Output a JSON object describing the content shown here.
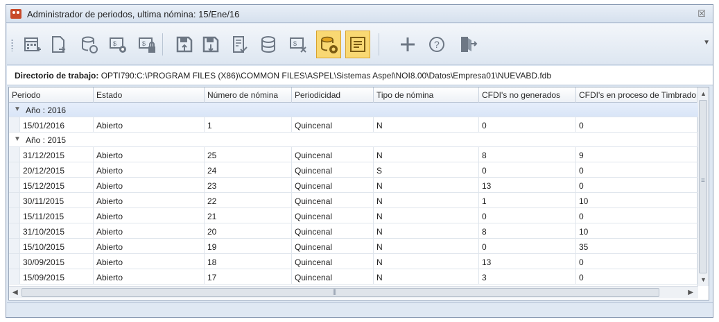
{
  "window": {
    "title": "Administrador de periodos, ultima nómina: 15/Ene/16",
    "close": "☒"
  },
  "toolbar": {
    "buttons": [
      {
        "name": "calendar-add-icon",
        "active": false
      },
      {
        "name": "document-arrow-icon",
        "active": false
      },
      {
        "name": "database-sync-icon",
        "active": false
      },
      {
        "name": "payroll-settings-icon",
        "active": false
      },
      {
        "name": "payroll-lock-icon",
        "active": false
      },
      {
        "name": "save-up-icon",
        "active": false
      },
      {
        "name": "save-down-icon",
        "active": false
      },
      {
        "name": "document-check-icon",
        "active": false
      },
      {
        "name": "database-list-icon",
        "active": false
      },
      {
        "name": "payroll-cancel-icon",
        "active": false
      },
      {
        "name": "database-gear-icon",
        "active": true
      },
      {
        "name": "notes-icon",
        "active": true
      },
      {
        "name": "add-icon",
        "active": false
      },
      {
        "name": "help-icon",
        "active": false
      },
      {
        "name": "exit-icon",
        "active": false
      }
    ]
  },
  "workdir": {
    "label": "Directorio de trabajo:",
    "path": " OPTI790:C:\\PROGRAM FILES (X86)\\COMMON FILES\\ASPEL\\Sistemas Aspel\\NOI8.00\\Datos\\Empresa01\\NUEVABD.fdb"
  },
  "grid": {
    "columns": [
      "Periodo",
      "Estado",
      "Número de nómina",
      "Periodicidad",
      "Tipo de nómina",
      "CFDI's no generados",
      "CFDI's en proceso de Timbrado"
    ],
    "groups": [
      {
        "label": "Año : 2016",
        "rows": [
          [
            "15/01/2016",
            "Abierto",
            "1",
            "Quincenal",
            "N",
            "0",
            "0"
          ]
        ]
      },
      {
        "label": "Año : 2015",
        "rows": [
          [
            "31/12/2015",
            "Abierto",
            "25",
            "Quincenal",
            "N",
            "8",
            "9"
          ],
          [
            "20/12/2015",
            "Abierto",
            "24",
            "Quincenal",
            "S",
            "0",
            "0"
          ],
          [
            "15/12/2015",
            "Abierto",
            "23",
            "Quincenal",
            "N",
            "13",
            "0"
          ],
          [
            "30/11/2015",
            "Abierto",
            "22",
            "Quincenal",
            "N",
            "1",
            "10"
          ],
          [
            "15/11/2015",
            "Abierto",
            "21",
            "Quincenal",
            "N",
            "0",
            "0"
          ],
          [
            "31/10/2015",
            "Abierto",
            "20",
            "Quincenal",
            "N",
            "8",
            "10"
          ],
          [
            "15/10/2015",
            "Abierto",
            "19",
            "Quincenal",
            "N",
            "0",
            "35"
          ],
          [
            "30/09/2015",
            "Abierto",
            "18",
            "Quincenal",
            "N",
            "13",
            "0"
          ],
          [
            "15/09/2015",
            "Abierto",
            "17",
            "Quincenal",
            "N",
            "3",
            "0"
          ]
        ]
      }
    ]
  }
}
